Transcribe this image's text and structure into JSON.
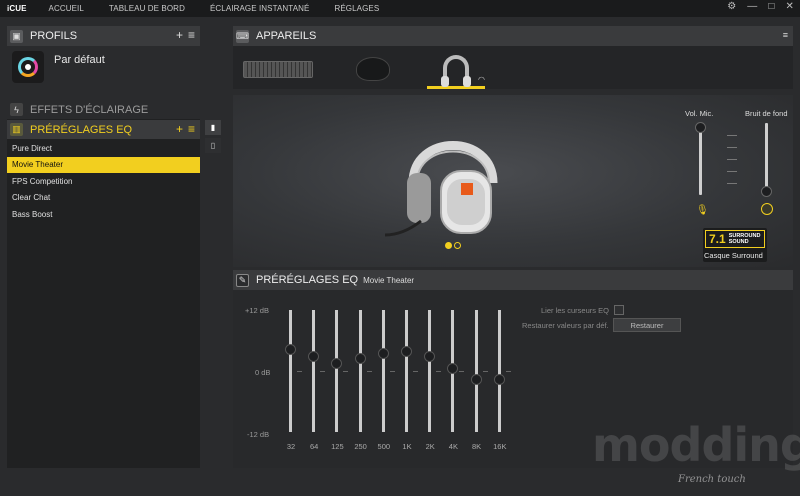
{
  "app": {
    "brand": "iCUE"
  },
  "nav": [
    "ACCUEIL",
    "TABLEAU DE BORD",
    "ÉCLAIRAGE INSTANTANÉ",
    "RÉGLAGES"
  ],
  "window_controls": {
    "settings": "⚙",
    "minimize": "—",
    "maximize": "□",
    "close": "✕"
  },
  "profiles": {
    "title": "PROFILS",
    "add": "+",
    "menu": "≡",
    "profile_name": "Par défaut"
  },
  "effects": {
    "title": "EFFETS D'ÉCLAIRAGE"
  },
  "eq_presets": {
    "title": "PRÉRÉGLAGES EQ",
    "add": "+",
    "menu": "≡",
    "items": [
      "Pure Direct",
      "Movie Theater",
      "FPS Competition",
      "Clear Chat",
      "Bass Boost"
    ],
    "selected": "Movie Theater"
  },
  "devices": {
    "title": "APPAREILS"
  },
  "mic": {
    "label": "Vol. Mic.",
    "level": 0.95
  },
  "noise": {
    "label": "Bruit de fond",
    "level": 0.05
  },
  "surround": {
    "number": "7.1",
    "line1": "SURROUND",
    "line2": "SOUND",
    "label": "Casque Surround"
  },
  "eq_panel": {
    "title": "PRÉRÉGLAGES EQ",
    "preset": "Movie Theater",
    "db_top": "+12 dB",
    "db_mid": "0 dB",
    "db_bottom": "-12 dB",
    "link_label": "Lier les curseurs EQ",
    "reset_label": "Restaurer valeurs par déf.",
    "reset_button": "Restaurer",
    "bands": [
      {
        "freq": "32",
        "db": 4.3
      },
      {
        "freq": "64",
        "db": 3.0
      },
      {
        "freq": "125",
        "db": 1.5
      },
      {
        "freq": "250",
        "db": 2.5
      },
      {
        "freq": "500",
        "db": 3.5
      },
      {
        "freq": "1K",
        "db": 4.0
      },
      {
        "freq": "2K",
        "db": 3.0
      },
      {
        "freq": "4K",
        "db": 0.5
      },
      {
        "freq": "8K",
        "db": -1.5
      },
      {
        "freq": "16K",
        "db": -1.5
      }
    ]
  },
  "watermark": {
    "text": "modding.fr",
    "sub": "French touch"
  },
  "colors": {
    "accent": "#f2cf1f",
    "panel": "#202122",
    "header": "#3a3b3d"
  }
}
